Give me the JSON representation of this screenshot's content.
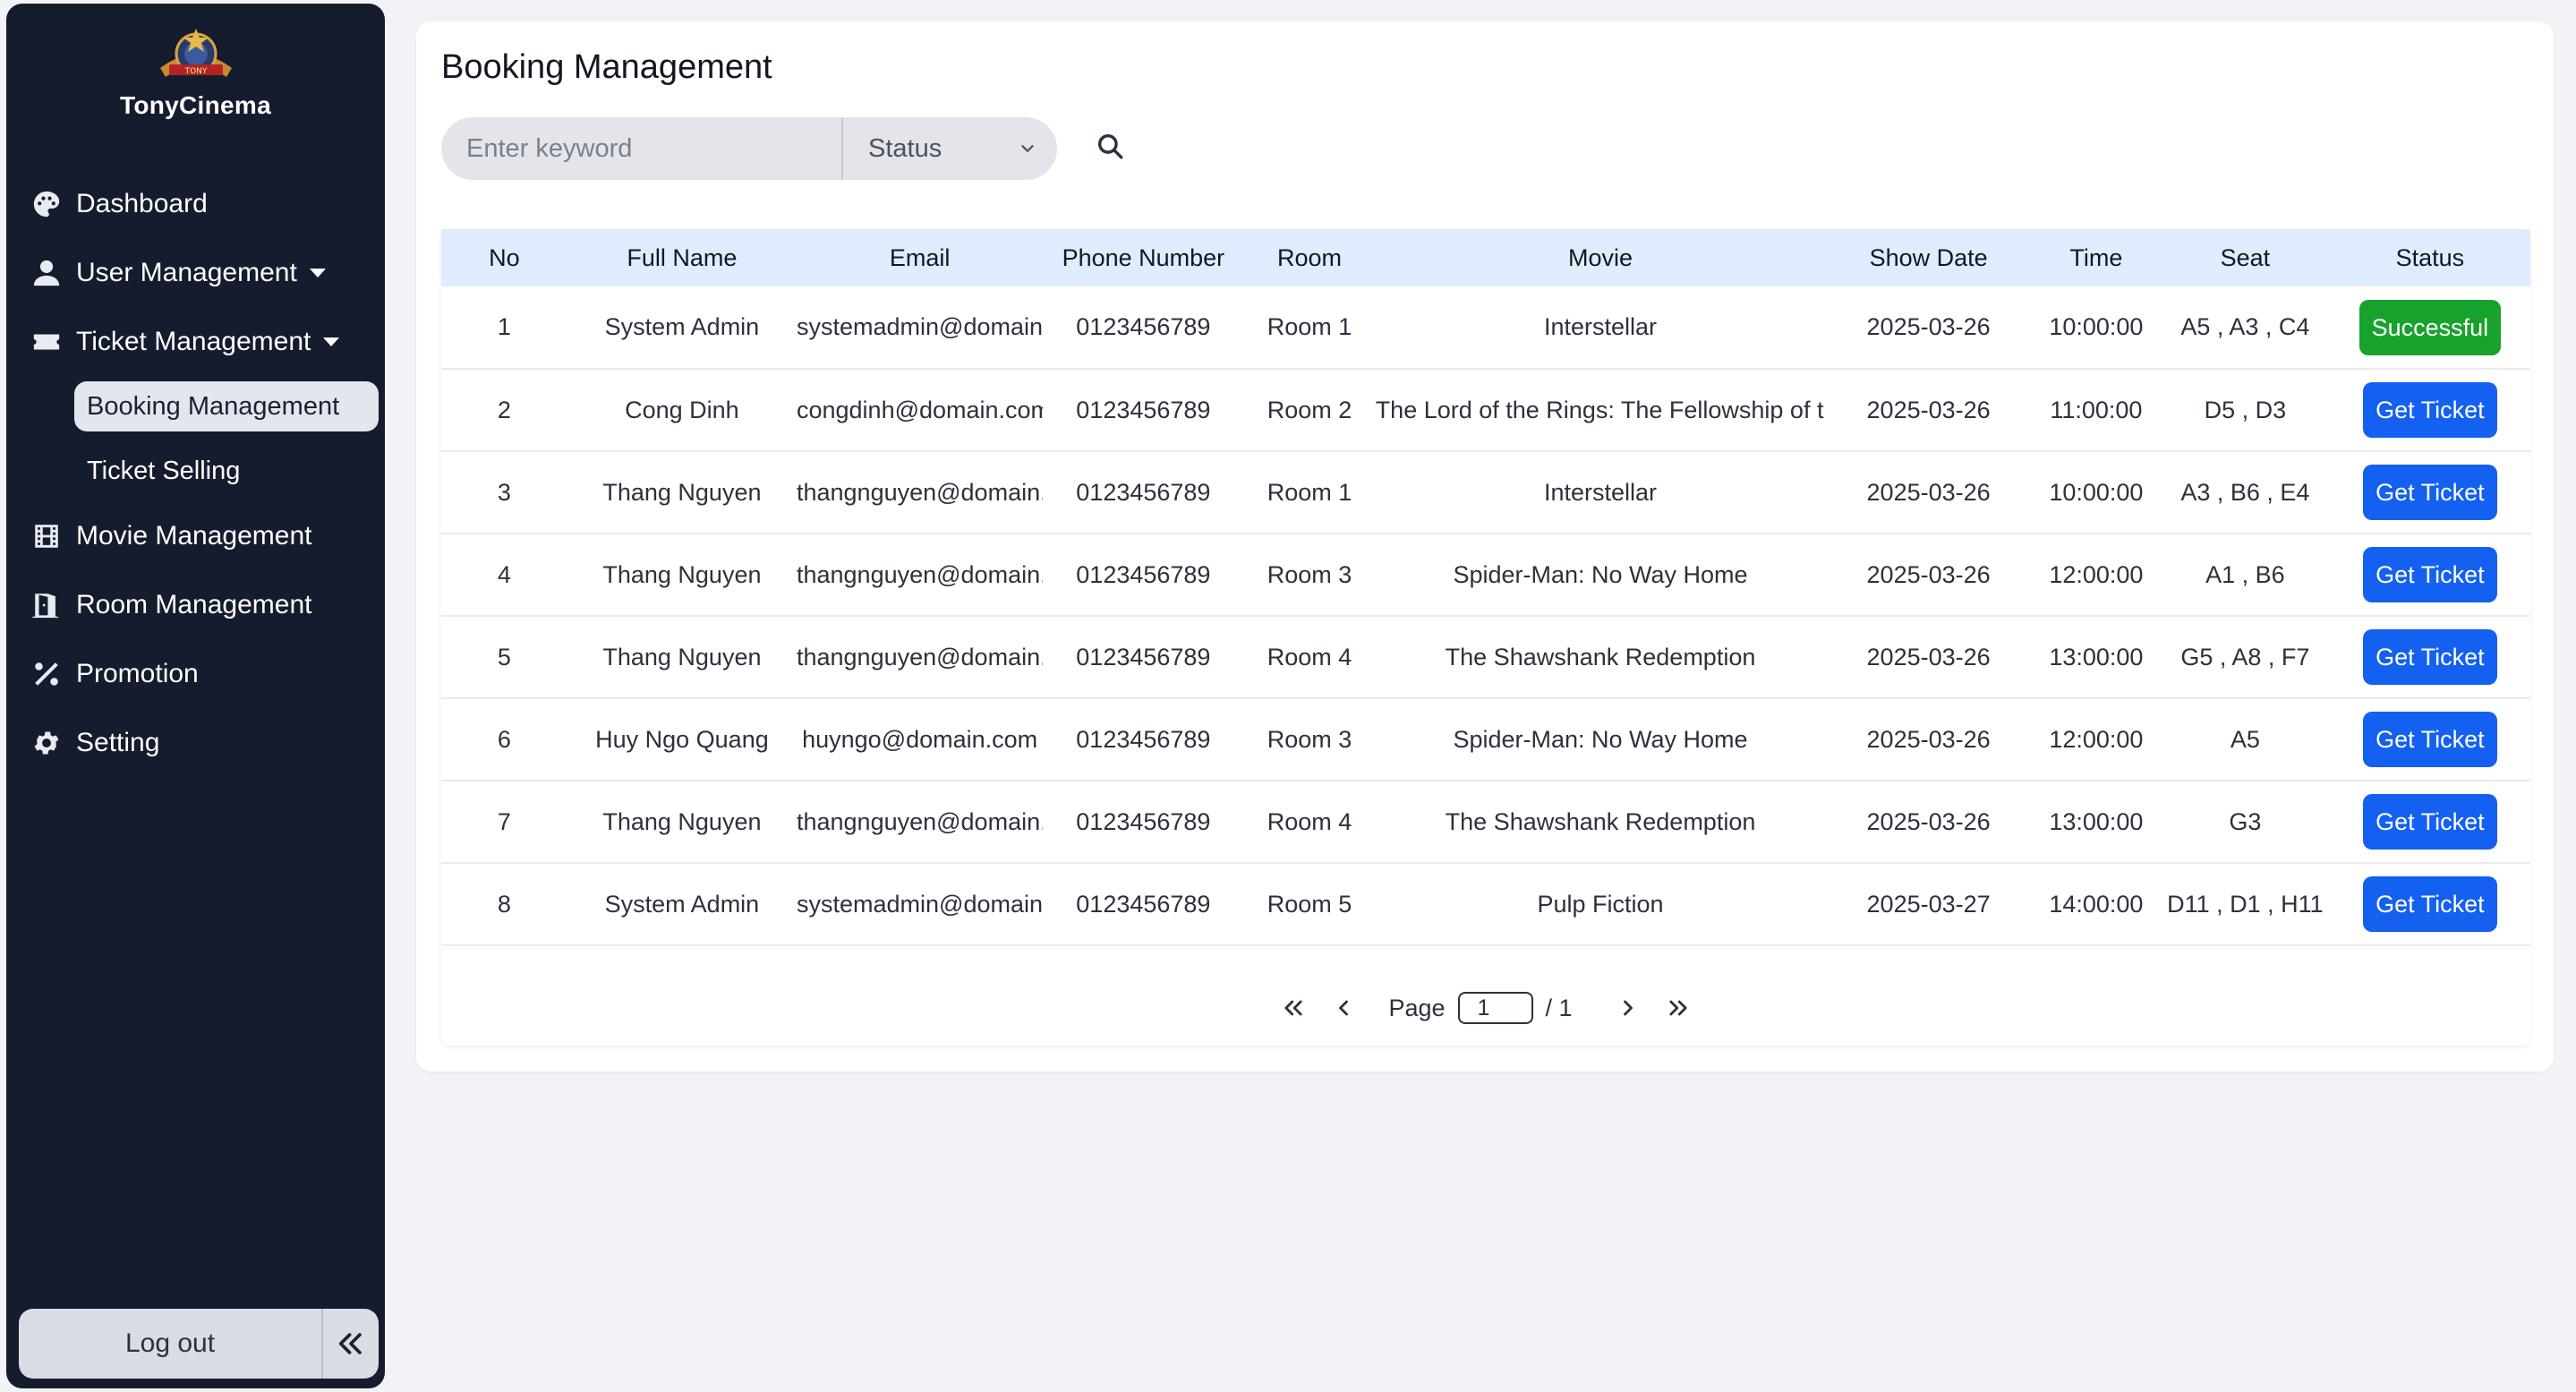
{
  "brand": {
    "name": "TonyCinema",
    "logo_text": "TONY"
  },
  "sidebar": {
    "items": [
      {
        "label": "Dashboard",
        "icon": "palette-icon"
      },
      {
        "label": "User Management",
        "icon": "user-icon"
      },
      {
        "label": "Ticket Management",
        "icon": "ticket-icon"
      },
      {
        "label": "Movie Management",
        "icon": "film-icon"
      },
      {
        "label": "Room Management",
        "icon": "door-icon"
      },
      {
        "label": "Promotion",
        "icon": "percent-icon"
      },
      {
        "label": "Setting",
        "icon": "gear-icon"
      }
    ],
    "sub_items": [
      {
        "label": "Booking Management",
        "active": true
      },
      {
        "label": "Ticket Selling",
        "active": false
      }
    ],
    "logout_label": "Log out"
  },
  "page": {
    "title": "Booking Management"
  },
  "filters": {
    "keyword_placeholder": "Enter keyword",
    "status_placeholder": "Status"
  },
  "table": {
    "columns": [
      "No",
      "Full Name",
      "Email",
      "Phone Number",
      "Room",
      "Movie",
      "Show Date",
      "Time",
      "Seat",
      "Status"
    ],
    "rows": [
      {
        "no": "1",
        "name": "System Admin",
        "email": "systemadmin@domain.com",
        "phone": "0123456789",
        "room": "Room 1",
        "movie": "Interstellar",
        "date": "2025-03-26",
        "time": "10:00:00",
        "seat": "A5 , A3 , C4",
        "status": "Successful",
        "status_type": "success"
      },
      {
        "no": "2",
        "name": "Cong Dinh",
        "email": "congdinh@domain.com",
        "phone": "0123456789",
        "room": "Room 2",
        "movie": "The Lord of the Rings: The Fellowship of the Ring",
        "date": "2025-03-26",
        "time": "11:00:00",
        "seat": "D5 , D3",
        "status": "Get Ticket",
        "status_type": "ticket"
      },
      {
        "no": "3",
        "name": "Thang Nguyen",
        "email": "thangnguyen@domain.com",
        "phone": "0123456789",
        "room": "Room 1",
        "movie": "Interstellar",
        "date": "2025-03-26",
        "time": "10:00:00",
        "seat": "A3 , B6 , E4",
        "status": "Get Ticket",
        "status_type": "ticket"
      },
      {
        "no": "4",
        "name": "Thang Nguyen",
        "email": "thangnguyen@domain.com",
        "phone": "0123456789",
        "room": "Room 3",
        "movie": "Spider-Man: No Way Home",
        "date": "2025-03-26",
        "time": "12:00:00",
        "seat": "A1 , B6",
        "status": "Get Ticket",
        "status_type": "ticket"
      },
      {
        "no": "5",
        "name": "Thang Nguyen",
        "email": "thangnguyen@domain.com",
        "phone": "0123456789",
        "room": "Room 4",
        "movie": "The Shawshank Redemption",
        "date": "2025-03-26",
        "time": "13:00:00",
        "seat": "G5 , A8 , F7",
        "status": "Get Ticket",
        "status_type": "ticket"
      },
      {
        "no": "6",
        "name": "Huy Ngo Quang",
        "email": "huyngo@domain.com",
        "phone": "0123456789",
        "room": "Room 3",
        "movie": "Spider-Man: No Way Home",
        "date": "2025-03-26",
        "time": "12:00:00",
        "seat": "A5",
        "status": "Get Ticket",
        "status_type": "ticket"
      },
      {
        "no": "7",
        "name": "Thang Nguyen",
        "email": "thangnguyen@domain.com",
        "phone": "0123456789",
        "room": "Room 4",
        "movie": "The Shawshank Redemption",
        "date": "2025-03-26",
        "time": "13:00:00",
        "seat": "G3",
        "status": "Get Ticket",
        "status_type": "ticket"
      },
      {
        "no": "8",
        "name": "System Admin",
        "email": "systemadmin@domain.com",
        "phone": "0123456789",
        "room": "Room 5",
        "movie": "Pulp Fiction",
        "date": "2025-03-27",
        "time": "14:00:00",
        "seat": "D11 , D1 , H11",
        "status": "Get Ticket",
        "status_type": "ticket"
      }
    ]
  },
  "pagination": {
    "page_label": "Page",
    "current": "1",
    "total": "/ 1"
  },
  "colors": {
    "sidebar_bg": "#141c2e",
    "header_bg": "#dfecfd",
    "success": "#17a22d",
    "primary": "#1460f0"
  }
}
